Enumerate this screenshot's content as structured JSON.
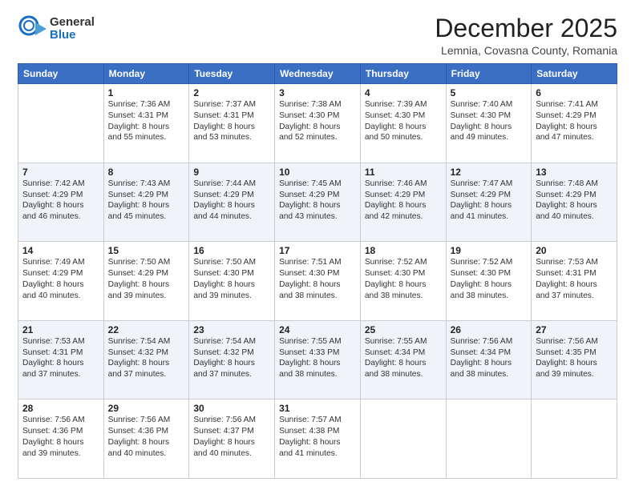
{
  "logo": {
    "general": "General",
    "blue": "Blue"
  },
  "title": "December 2025",
  "subtitle": "Lemnia, Covasna County, Romania",
  "weekdays": [
    "Sunday",
    "Monday",
    "Tuesday",
    "Wednesday",
    "Thursday",
    "Friday",
    "Saturday"
  ],
  "weeks": [
    [
      {
        "day": "",
        "info": ""
      },
      {
        "day": "1",
        "info": "Sunrise: 7:36 AM\nSunset: 4:31 PM\nDaylight: 8 hours\nand 55 minutes."
      },
      {
        "day": "2",
        "info": "Sunrise: 7:37 AM\nSunset: 4:31 PM\nDaylight: 8 hours\nand 53 minutes."
      },
      {
        "day": "3",
        "info": "Sunrise: 7:38 AM\nSunset: 4:30 PM\nDaylight: 8 hours\nand 52 minutes."
      },
      {
        "day": "4",
        "info": "Sunrise: 7:39 AM\nSunset: 4:30 PM\nDaylight: 8 hours\nand 50 minutes."
      },
      {
        "day": "5",
        "info": "Sunrise: 7:40 AM\nSunset: 4:30 PM\nDaylight: 8 hours\nand 49 minutes."
      },
      {
        "day": "6",
        "info": "Sunrise: 7:41 AM\nSunset: 4:29 PM\nDaylight: 8 hours\nand 47 minutes."
      }
    ],
    [
      {
        "day": "7",
        "info": "Sunrise: 7:42 AM\nSunset: 4:29 PM\nDaylight: 8 hours\nand 46 minutes."
      },
      {
        "day": "8",
        "info": "Sunrise: 7:43 AM\nSunset: 4:29 PM\nDaylight: 8 hours\nand 45 minutes."
      },
      {
        "day": "9",
        "info": "Sunrise: 7:44 AM\nSunset: 4:29 PM\nDaylight: 8 hours\nand 44 minutes."
      },
      {
        "day": "10",
        "info": "Sunrise: 7:45 AM\nSunset: 4:29 PM\nDaylight: 8 hours\nand 43 minutes."
      },
      {
        "day": "11",
        "info": "Sunrise: 7:46 AM\nSunset: 4:29 PM\nDaylight: 8 hours\nand 42 minutes."
      },
      {
        "day": "12",
        "info": "Sunrise: 7:47 AM\nSunset: 4:29 PM\nDaylight: 8 hours\nand 41 minutes."
      },
      {
        "day": "13",
        "info": "Sunrise: 7:48 AM\nSunset: 4:29 PM\nDaylight: 8 hours\nand 40 minutes."
      }
    ],
    [
      {
        "day": "14",
        "info": "Sunrise: 7:49 AM\nSunset: 4:29 PM\nDaylight: 8 hours\nand 40 minutes."
      },
      {
        "day": "15",
        "info": "Sunrise: 7:50 AM\nSunset: 4:29 PM\nDaylight: 8 hours\nand 39 minutes."
      },
      {
        "day": "16",
        "info": "Sunrise: 7:50 AM\nSunset: 4:30 PM\nDaylight: 8 hours\nand 39 minutes."
      },
      {
        "day": "17",
        "info": "Sunrise: 7:51 AM\nSunset: 4:30 PM\nDaylight: 8 hours\nand 38 minutes."
      },
      {
        "day": "18",
        "info": "Sunrise: 7:52 AM\nSunset: 4:30 PM\nDaylight: 8 hours\nand 38 minutes."
      },
      {
        "day": "19",
        "info": "Sunrise: 7:52 AM\nSunset: 4:30 PM\nDaylight: 8 hours\nand 38 minutes."
      },
      {
        "day": "20",
        "info": "Sunrise: 7:53 AM\nSunset: 4:31 PM\nDaylight: 8 hours\nand 37 minutes."
      }
    ],
    [
      {
        "day": "21",
        "info": "Sunrise: 7:53 AM\nSunset: 4:31 PM\nDaylight: 8 hours\nand 37 minutes."
      },
      {
        "day": "22",
        "info": "Sunrise: 7:54 AM\nSunset: 4:32 PM\nDaylight: 8 hours\nand 37 minutes."
      },
      {
        "day": "23",
        "info": "Sunrise: 7:54 AM\nSunset: 4:32 PM\nDaylight: 8 hours\nand 37 minutes."
      },
      {
        "day": "24",
        "info": "Sunrise: 7:55 AM\nSunset: 4:33 PM\nDaylight: 8 hours\nand 38 minutes."
      },
      {
        "day": "25",
        "info": "Sunrise: 7:55 AM\nSunset: 4:34 PM\nDaylight: 8 hours\nand 38 minutes."
      },
      {
        "day": "26",
        "info": "Sunrise: 7:56 AM\nSunset: 4:34 PM\nDaylight: 8 hours\nand 38 minutes."
      },
      {
        "day": "27",
        "info": "Sunrise: 7:56 AM\nSunset: 4:35 PM\nDaylight: 8 hours\nand 39 minutes."
      }
    ],
    [
      {
        "day": "28",
        "info": "Sunrise: 7:56 AM\nSunset: 4:36 PM\nDaylight: 8 hours\nand 39 minutes."
      },
      {
        "day": "29",
        "info": "Sunrise: 7:56 AM\nSunset: 4:36 PM\nDaylight: 8 hours\nand 40 minutes."
      },
      {
        "day": "30",
        "info": "Sunrise: 7:56 AM\nSunset: 4:37 PM\nDaylight: 8 hours\nand 40 minutes."
      },
      {
        "day": "31",
        "info": "Sunrise: 7:57 AM\nSunset: 4:38 PM\nDaylight: 8 hours\nand 41 minutes."
      },
      {
        "day": "",
        "info": ""
      },
      {
        "day": "",
        "info": ""
      },
      {
        "day": "",
        "info": ""
      }
    ]
  ]
}
